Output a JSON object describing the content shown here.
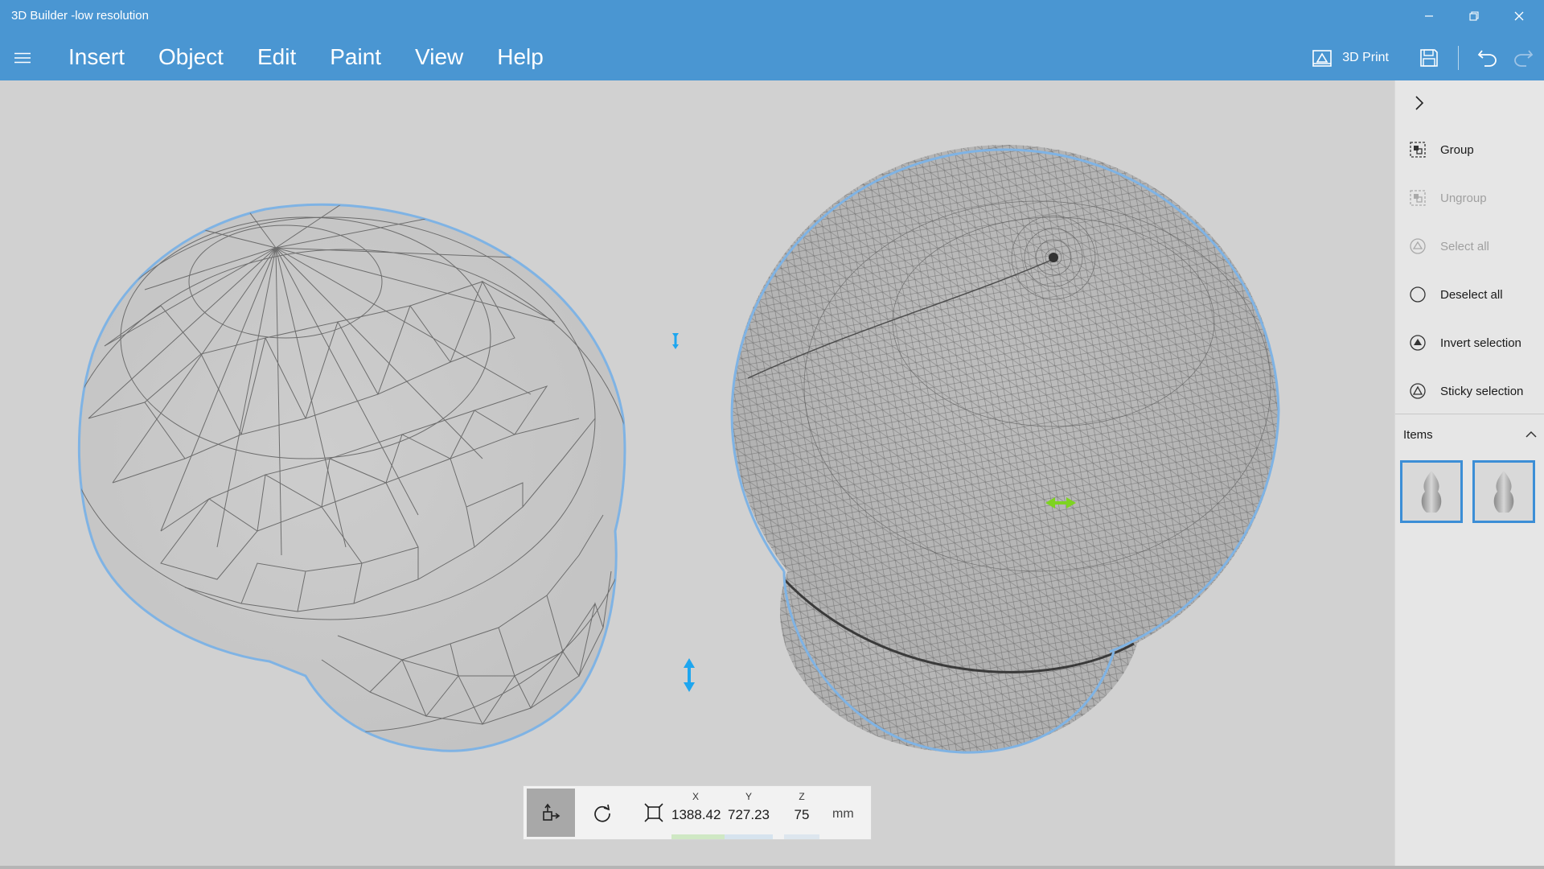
{
  "window": {
    "title": "3D Builder -low resolution"
  },
  "menu": {
    "items": [
      "Insert",
      "Object",
      "Edit",
      "Paint",
      "View",
      "Help"
    ]
  },
  "toolbar": {
    "print_label": "3D Print"
  },
  "panel": {
    "actions": [
      {
        "label": "Group",
        "enabled": true,
        "icon": "group-icon"
      },
      {
        "label": "Ungroup",
        "enabled": false,
        "icon": "ungroup-icon"
      },
      {
        "label": "Select all",
        "enabled": false,
        "icon": "select-all-icon"
      },
      {
        "label": "Deselect all",
        "enabled": true,
        "icon": "deselect-all-icon"
      },
      {
        "label": "Invert selection",
        "enabled": true,
        "icon": "invert-selection-icon"
      },
      {
        "label": "Sticky selection",
        "enabled": true,
        "icon": "sticky-selection-icon"
      }
    ],
    "items_label": "Items"
  },
  "transform": {
    "x_label": "X",
    "x_value": "1388.42",
    "y_label": "Y",
    "y_value": "727.23",
    "z_label": "Z",
    "z_value": "75",
    "units": "mm"
  },
  "colors": {
    "accent": "#4a96d2",
    "selection": "#3c8ed6",
    "gizmo_blue": "#1ea6ef",
    "gizmo_green": "#7ed321"
  }
}
